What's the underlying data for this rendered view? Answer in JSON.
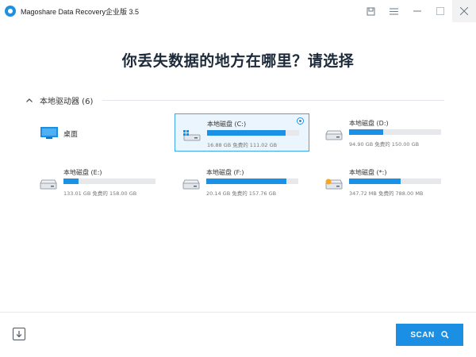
{
  "window": {
    "title": "Magoshare Data Recovery企业版 3.5"
  },
  "main": {
    "headline": "你丢失数据的地方在哪里？请选择",
    "section_label": "本地驱动器 (6)"
  },
  "items": [
    {
      "name": "桌面",
      "type": "desktop"
    },
    {
      "name": "本地磁盘 (C:)",
      "size": "16.88 GB 免费的 111.02 GB",
      "used_fraction": 0.85,
      "selected": true,
      "icon": "windows-drive-icon"
    },
    {
      "name": "本地磁盘 (D:)",
      "size": "94.90 GB 免费的 150.00 GB",
      "used_fraction": 0.37,
      "selected": false,
      "icon": "drive-icon"
    },
    {
      "name": "本地磁盘 (E:)",
      "size": "133.01 GB 免费的 158.00 GB",
      "used_fraction": 0.16,
      "selected": false,
      "icon": "drive-icon"
    },
    {
      "name": "本地磁盘 (F:)",
      "size": "20.14 GB 免费的 157.76 GB",
      "used_fraction": 0.87,
      "selected": false,
      "icon": "drive-icon"
    },
    {
      "name": "本地磁盘 (*:)",
      "size": "347.72 MB 免费的 788.00 MB",
      "used_fraction": 0.56,
      "selected": false,
      "icon": "unknown-drive-icon"
    }
  ],
  "footer": {
    "scan_label": "SCAN"
  },
  "colors": {
    "accent": "#1b8fe4",
    "selected_bg": "#eaf5fd",
    "selected_border": "#3ea6ee"
  }
}
